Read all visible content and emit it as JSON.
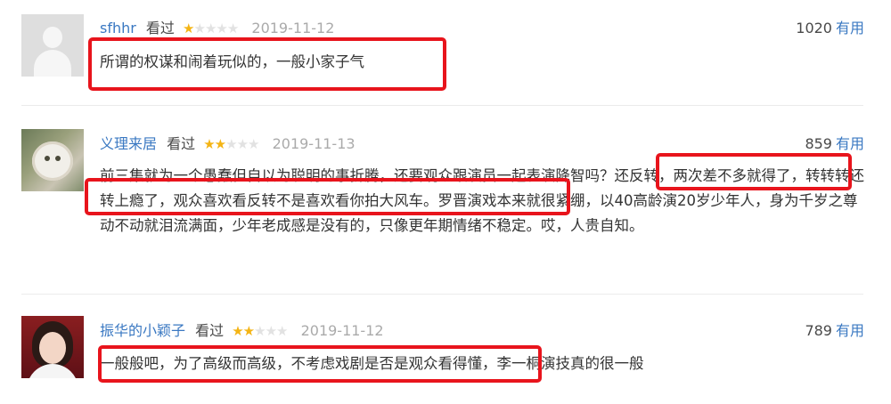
{
  "comments": [
    {
      "username": "sfhhr",
      "status": "看过",
      "rating": 1,
      "date": "2019-11-12",
      "votes": "1020",
      "vote_label": "有用",
      "content": "所谓的权谋和闹着玩似的，一般小家子气"
    },
    {
      "username": "义理来居",
      "status": "看过",
      "rating": 2,
      "date": "2019-11-13",
      "votes": "859",
      "vote_label": "有用",
      "content": "前三集就为一个愚蠢但自以为聪明的事折腾，还要观众跟演员一起表演降智吗？还反转，两次差不多就得了，转转转还转上瘾了，观众喜欢看反转不是喜欢看你拍大风车。罗晋演戏本来就很紧绷，以40高龄演20岁少年人，身为千岁之尊动不动就泪流满面，少年老成感是没有的，只像更年期情绪不稳定。哎，人贵自知。"
    },
    {
      "username": "振华的小颖子",
      "status": "看过",
      "rating": 2,
      "date": "2019-11-12",
      "votes": "789",
      "vote_label": "有用",
      "content": "一般般吧，为了高级而高级，不考虑戏剧是否是观众看得懂，李一桐演技真的很一般"
    }
  ],
  "icons": {
    "avatar_1": "default-user-icon",
    "avatar_2": "cat-avatar",
    "avatar_3": "portrait-avatar",
    "star": "star-icon"
  },
  "colors": {
    "link": "#3a78c2",
    "star_on": "#f4b414",
    "star_off": "#e2e2e2",
    "highlight": "#e8141c"
  }
}
